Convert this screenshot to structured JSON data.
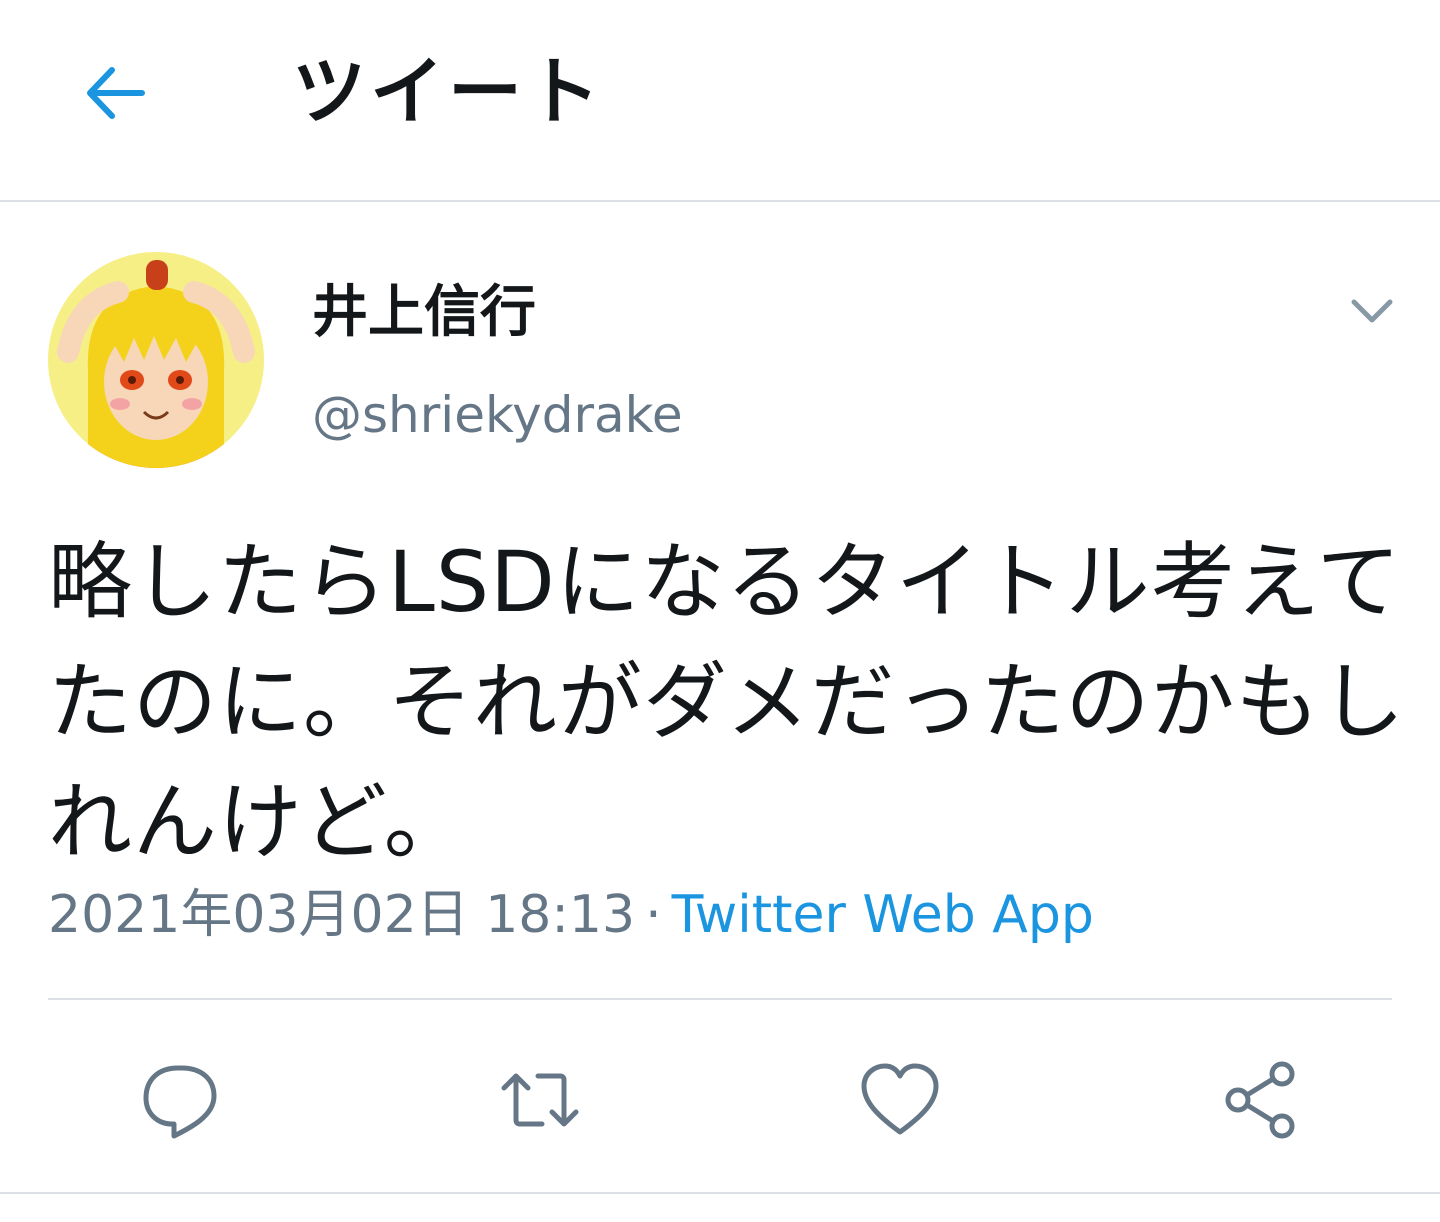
{
  "header": {
    "title": "ツイート",
    "back_icon": "arrow-left-icon"
  },
  "tweet": {
    "author": {
      "display_name": "井上信行",
      "handle": "@shriekydrake",
      "avatar": "anime-girl-avatar"
    },
    "menu_icon": "chevron-down-icon",
    "text": "略したらLSDになるタイトル考えてたのに。それがダメだったのかもしれんけど。",
    "timestamp": "2021年03月02日 18:13",
    "separator": "·",
    "source": "Twitter Web App"
  },
  "actions": [
    {
      "name": "reply",
      "icon": "reply-icon"
    },
    {
      "name": "retweet",
      "icon": "retweet-icon"
    },
    {
      "name": "like",
      "icon": "heart-icon"
    },
    {
      "name": "share",
      "icon": "share-icon"
    }
  ],
  "colors": {
    "accent": "#1b95e0",
    "text": "#14171a",
    "secondary": "#657786",
    "divider": "#dcdfe3"
  }
}
